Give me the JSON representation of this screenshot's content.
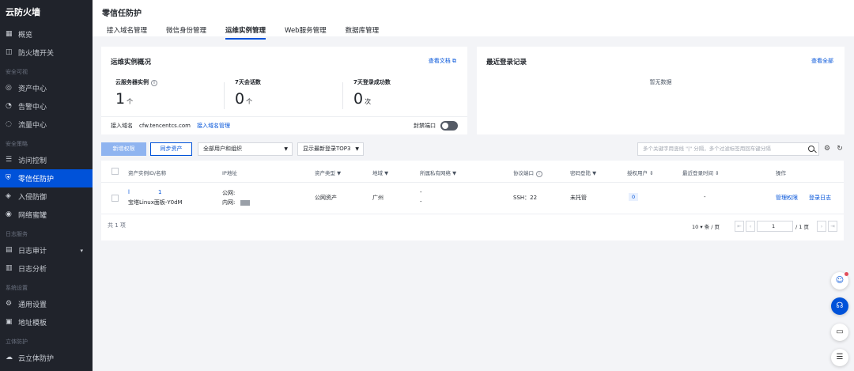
{
  "sidebar": {
    "brand": "云防火墙",
    "items": [
      {
        "type": "item",
        "label": "概览",
        "icon": "grid-icon"
      },
      {
        "type": "item",
        "label": "防火墙开关",
        "icon": "switch-icon"
      },
      {
        "type": "group",
        "label": "安全可视"
      },
      {
        "type": "item",
        "label": "资产中心",
        "icon": "asset-icon"
      },
      {
        "type": "item",
        "label": "告警中心",
        "icon": "alarm-icon"
      },
      {
        "type": "item",
        "label": "流量中心",
        "icon": "traffic-icon"
      },
      {
        "type": "group",
        "label": "安全策略"
      },
      {
        "type": "item",
        "label": "访问控制",
        "icon": "list-icon"
      },
      {
        "type": "item",
        "label": "零信任防护",
        "icon": "shield-icon",
        "active": true
      },
      {
        "type": "item",
        "label": "入侵防御",
        "icon": "defense-icon"
      },
      {
        "type": "item",
        "label": "网络蜜罐",
        "icon": "honeypot-icon"
      },
      {
        "type": "group",
        "label": "日志服务"
      },
      {
        "type": "item",
        "label": "日志审计",
        "icon": "audit-icon",
        "caret": true
      },
      {
        "type": "item",
        "label": "日志分析",
        "icon": "analysis-icon"
      },
      {
        "type": "group",
        "label": "系统设置"
      },
      {
        "type": "item",
        "label": "通用设置",
        "icon": "settings-icon"
      },
      {
        "type": "item",
        "label": "地址模板",
        "icon": "template-icon"
      },
      {
        "type": "group",
        "label": "立体防护"
      },
      {
        "type": "item",
        "label": "云立体防护",
        "icon": "cloud-icon"
      }
    ]
  },
  "header": {
    "title": "零信任防护",
    "tabs": [
      "接入域名管理",
      "微信身份管理",
      "运维实例管理",
      "Web服务管理",
      "数据库管理"
    ],
    "active_tab": 2
  },
  "overview": {
    "title": "运维实例概况",
    "doc_link": "查看文档",
    "stats": [
      {
        "label": "云服务器实例",
        "value": "1",
        "unit": "个",
        "info": true
      },
      {
        "label": "7天会话数",
        "value": "0",
        "unit": "个"
      },
      {
        "label": "7天登录成功数",
        "value": "0",
        "unit": "次"
      }
    ],
    "domain_label": "接入域名",
    "domain_value": "cfw.tencentcs.com",
    "domain_manage": "接入域名管理",
    "port_label": "封禁端口"
  },
  "login": {
    "title": "最近登录记录",
    "view_all": "查看全部",
    "empty": "暂无数据"
  },
  "toolbar": {
    "new_auth": "新增权限",
    "sync_assets": "同步资产",
    "user_filter": "全部用户和组织",
    "top3": "显示最新登录TOP3",
    "search_placeholder": "多个关键字用竖线 \"|\" 分隔，多个过滤标签用回车键分隔"
  },
  "table": {
    "columns": [
      "资产实例ID/名称",
      "IP地址",
      "资产类型",
      "地域",
      "所属私有网络",
      "协议端口",
      "密码登陆",
      "授权用户",
      "最近登录时间",
      "操作"
    ],
    "rows": [
      {
        "id": "l",
        "id_tail": "1",
        "name": "宝塔Linux面板-Y0dM",
        "ip_public": "公网: ",
        "ip_private": "内网: ",
        "asset_type": "公网资产",
        "region": "广州",
        "vpc_line1": "-",
        "vpc_line2": "-",
        "port": "SSH：22",
        "password_login": "未托管",
        "auth_users": "0",
        "last_login": "-",
        "action_manage": "管理权限",
        "action_log": "登录日志"
      }
    ],
    "total": "共 1 项",
    "page_size": "10",
    "page_size_suffix": "条 / 页",
    "current_page": "1",
    "total_pages": "/ 1 页"
  },
  "colors": {
    "primary": "#0052d9",
    "sidebar_bg": "#20232b"
  }
}
